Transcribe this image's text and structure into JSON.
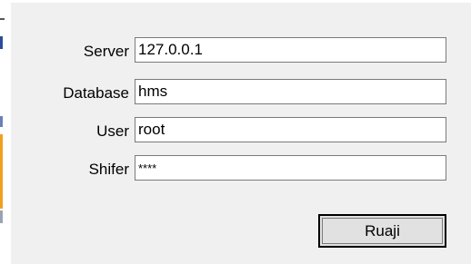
{
  "form": {
    "server": {
      "label": "Server",
      "value": "127.0.0.1"
    },
    "database": {
      "label": "Database",
      "value": "hms"
    },
    "user": {
      "label": "User",
      "value": "root"
    },
    "password": {
      "label": "Shifer",
      "value": "****"
    }
  },
  "actions": {
    "connect_label": "Ruaji"
  },
  "colors": {
    "dialog_background": "#f0f0f0",
    "field_border": "#7a7a7a",
    "button_face": "#e1e1e1"
  }
}
